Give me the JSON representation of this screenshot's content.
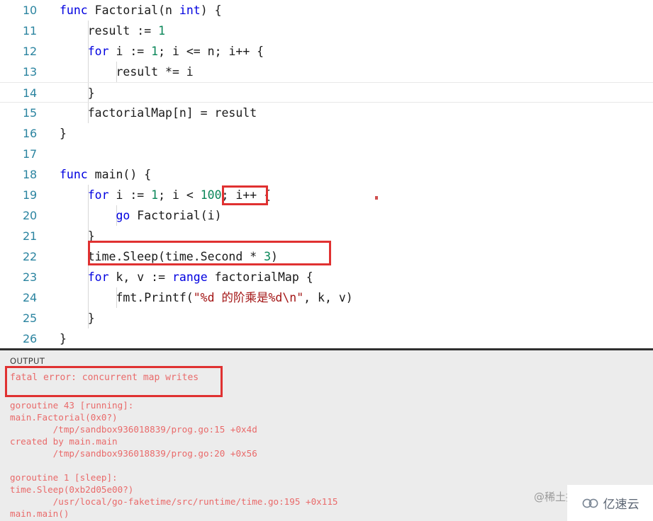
{
  "editor": {
    "language": "go",
    "first_line_number": 10,
    "active_line_number": 14,
    "lines": [
      {
        "n": "10",
        "text": "func Factorial(n int) {"
      },
      {
        "n": "11",
        "text": "    result := 1"
      },
      {
        "n": "12",
        "text": "    for i := 1; i <= n; i++ {"
      },
      {
        "n": "13",
        "text": "        result *= i"
      },
      {
        "n": "14",
        "text": "    }"
      },
      {
        "n": "15",
        "text": "    factorialMap[n] = result"
      },
      {
        "n": "16",
        "text": "}"
      },
      {
        "n": "17",
        "text": ""
      },
      {
        "n": "18",
        "text": "func main() {"
      },
      {
        "n": "19",
        "text": "    for i := 1; i < 100; i++ {"
      },
      {
        "n": "20",
        "text": "        go Factorial(i)"
      },
      {
        "n": "21",
        "text": "    }"
      },
      {
        "n": "22",
        "text": "    time.Sleep(time.Second * 3)"
      },
      {
        "n": "23",
        "text": "    for k, v := range factorialMap {"
      },
      {
        "n": "24",
        "text": "        fmt.Printf(\"%d 的阶乘是%d\\n\", k, v)"
      },
      {
        "n": "25",
        "text": "    }"
      },
      {
        "n": "26",
        "text": "}"
      }
    ],
    "annotations": [
      {
        "name": "loop-bound-highlight",
        "target": "100;",
        "line": "19"
      },
      {
        "name": "sleep-call-highlight",
        "target": "time.Sleep(time.Second * 3)",
        "line": "22"
      }
    ]
  },
  "output": {
    "label": "OUTPUT",
    "error_message": "fatal error: concurrent map writes",
    "trace": [
      "goroutine 43 [running]:",
      "main.Factorial(0x0?)",
      "        /tmp/sandbox936018839/prog.go:15 +0x4d",
      "created by main.main",
      "        /tmp/sandbox936018839/prog.go:20 +0x56",
      "",
      "goroutine 1 [sleep]:",
      "time.Sleep(0xb2d05e00?)",
      "        /usr/local/go-faketime/src/runtime/time.go:195 +0x115",
      "main.main()"
    ]
  },
  "watermarks": {
    "juejin": "@稀土掘金",
    "yisuyun": "亿速云"
  },
  "colors": {
    "keyword": "#0000e0",
    "number": "#098658",
    "string": "#a31515",
    "plain": "#1a1a1a",
    "lineno": "#2b84a0",
    "annotation": "#e03131",
    "output_text": "#e96a6a",
    "output_bg": "#ececec"
  }
}
